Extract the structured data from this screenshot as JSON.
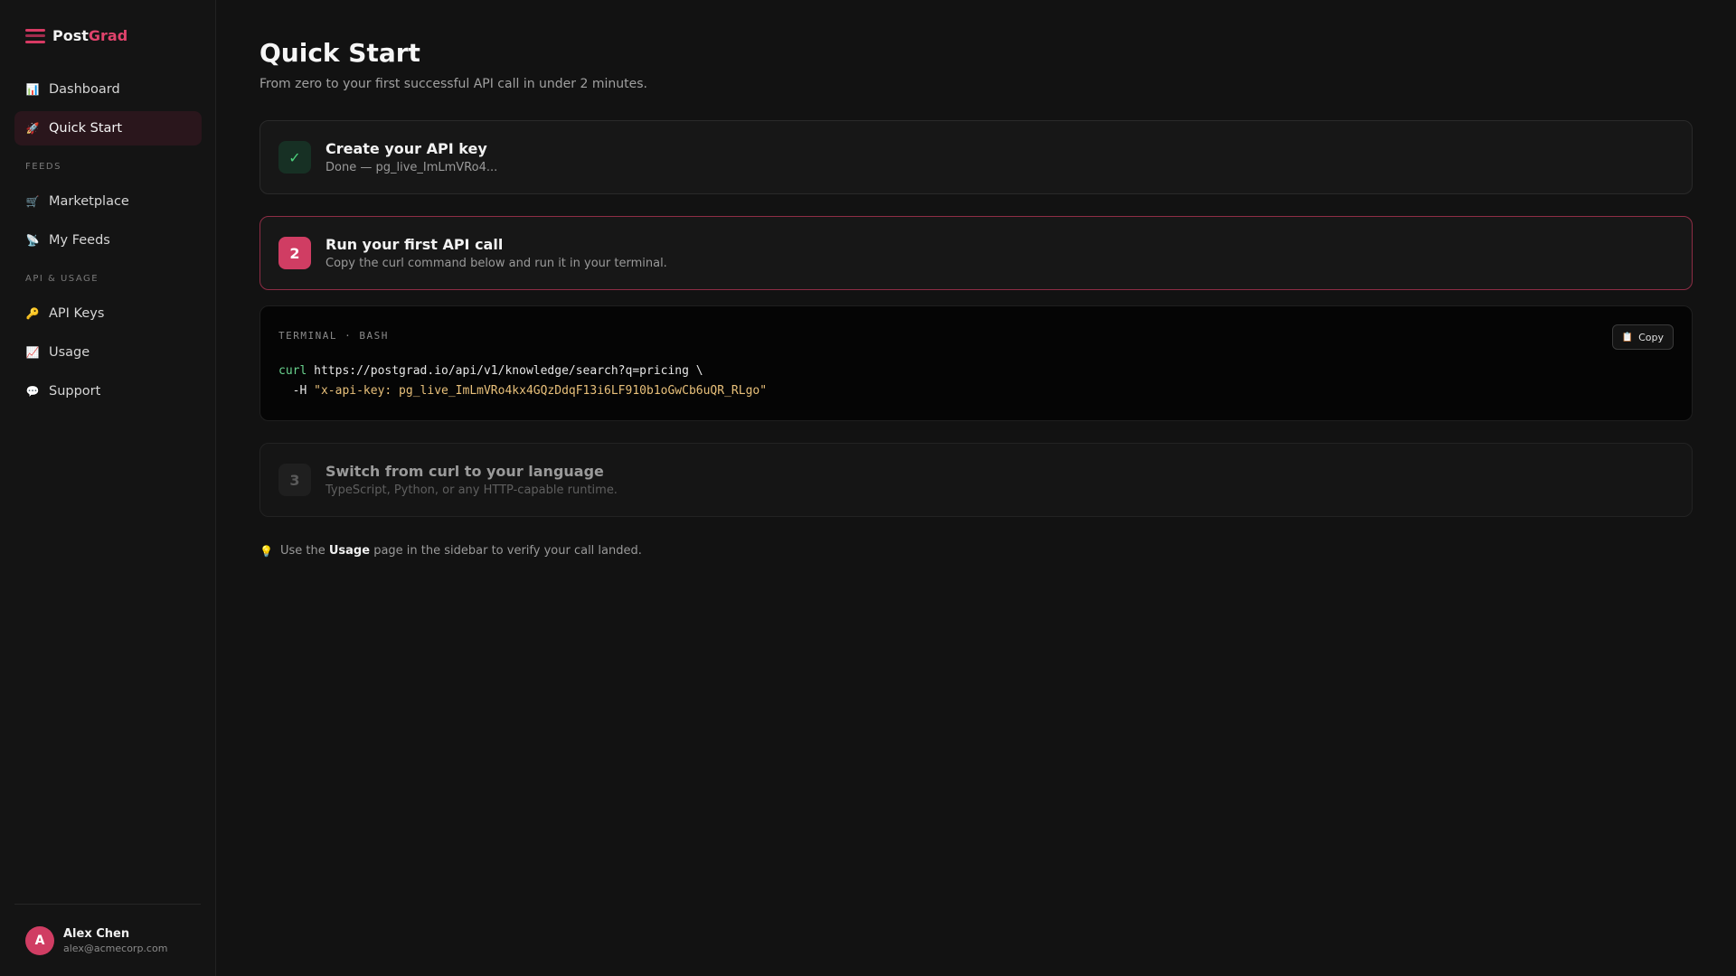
{
  "brand": {
    "part1": "Post",
    "part2": "Grad"
  },
  "sidebar": {
    "items": [
      {
        "label": "Dashboard",
        "icon": "chart-icon",
        "glyph": "📊",
        "active": false
      },
      {
        "label": "Quick Start",
        "icon": "rocket-icon",
        "glyph": "🚀",
        "active": true
      }
    ],
    "sections": [
      {
        "title": "FEEDS",
        "items": [
          {
            "label": "Marketplace",
            "icon": "cart-icon",
            "glyph": "🛒"
          },
          {
            "label": "My Feeds",
            "icon": "satellite-icon",
            "glyph": "📡"
          }
        ]
      },
      {
        "title": "API & USAGE",
        "items": [
          {
            "label": "API Keys",
            "icon": "key-icon",
            "glyph": "🔑"
          },
          {
            "label": "Usage",
            "icon": "trend-icon",
            "glyph": "📈"
          },
          {
            "label": "Support",
            "icon": "speech-bubble-icon",
            "glyph": "💬"
          }
        ]
      }
    ]
  },
  "user": {
    "initial": "A",
    "name": "Alex Chen",
    "email": "alex@acmecorp.com"
  },
  "main": {
    "title": "Quick Start",
    "subtitle": "From zero to your first successful API call in under 2 minutes.",
    "steps": [
      {
        "badge": "✓",
        "title": "Create your API key",
        "desc": "Done — pg_live_ImLmVRo4...",
        "state": "done"
      },
      {
        "badge": "2",
        "title": "Run your first API call",
        "desc": "Copy the curl command below and run it in your terminal.",
        "state": "active"
      },
      {
        "badge": "3",
        "title": "Switch from curl to your language",
        "desc": "TypeScript, Python, or any HTTP-capable runtime.",
        "state": "pending"
      }
    ],
    "terminal": {
      "label": "TERMINAL · BASH",
      "copy_label": "Copy",
      "line1_cmd": "curl",
      "line1_rest": " https://postgrad.io/api/v1/knowledge/search?q=pricing \\",
      "line2_flag": "  -H ",
      "line2_str": "\"x-api-key: pg_live_ImLmVRo4kx4GQzDdqF13i6LF910b1oGwCb6uQR_RLgo\""
    },
    "tip": {
      "prefix": "Use the",
      "bold": "Usage",
      "suffix": "page in the sidebar to verify your call landed."
    }
  },
  "colors": {
    "accent": "#d03d63",
    "success": "#4cd17c",
    "background": "#121212"
  }
}
